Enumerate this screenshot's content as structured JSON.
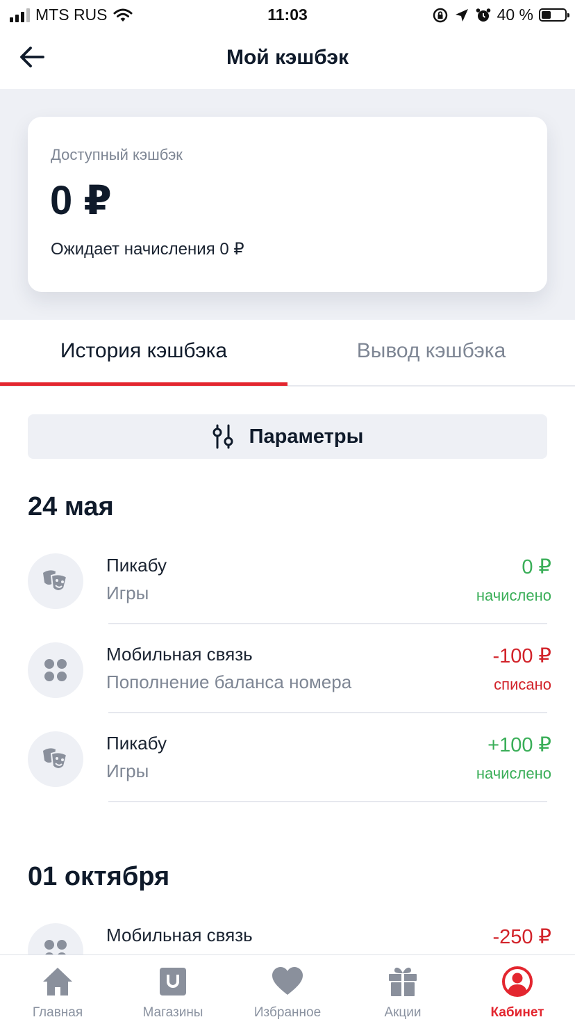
{
  "status_bar": {
    "carrier": "MTS RUS",
    "time": "11:03",
    "battery": "40 %",
    "battery_level": 0.4
  },
  "header": {
    "title": "Мой кэшбэк"
  },
  "balance": {
    "label": "Доступный кэшбэк",
    "amount": "0 ₽",
    "pending": "Ожидает начисления 0 ₽"
  },
  "tabs": [
    {
      "label": "История кэшбэка",
      "active": true
    },
    {
      "label": "Вывод кэшбэка",
      "active": false
    }
  ],
  "params_label": "Параметры",
  "groups": [
    {
      "date": "24 мая",
      "items": [
        {
          "title": "Пикабу",
          "subtitle": "Игры",
          "amount": "0 ₽",
          "status": "начислено",
          "icon": "theater-masks-icon",
          "color": "#3aae58"
        },
        {
          "title": "Мобильная связь",
          "subtitle": "Пополнение баланса номера",
          "amount": "-100 ₽",
          "status": "списано",
          "icon": "four-dots-icon",
          "color": "#d2232a"
        },
        {
          "title": "Пикабу",
          "subtitle": "Игры",
          "amount": "+100 ₽",
          "status": "начислено",
          "icon": "theater-masks-icon",
          "color": "#3aae58"
        }
      ]
    },
    {
      "date": "01 октября",
      "items": [
        {
          "title": "Мобильная связь",
          "amount": "-250 ₽",
          "icon": "four-dots-icon",
          "color": "#d2232a"
        }
      ]
    }
  ],
  "bottom_nav": [
    {
      "label": "Главная",
      "icon": "home-icon"
    },
    {
      "label": "Магазины",
      "icon": "shop-bag-icon"
    },
    {
      "label": "Избранное",
      "icon": "heart-icon"
    },
    {
      "label": "Акции",
      "icon": "gift-icon"
    },
    {
      "label": "Кабинет",
      "icon": "profile-icon",
      "active": true
    }
  ],
  "colors": {
    "accent": "#e3262f",
    "positive": "#3aae58",
    "negative": "#d2232a"
  }
}
